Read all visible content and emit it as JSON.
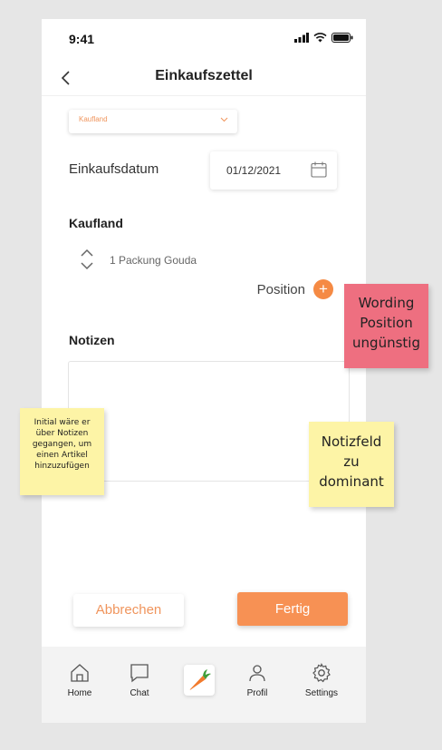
{
  "status_bar": {
    "time": "9:41"
  },
  "header": {
    "title": "Einkaufszettel"
  },
  "store_select": {
    "value": "Kaufland"
  },
  "date": {
    "label": "Einkaufsdatum",
    "value": "01/12/2021"
  },
  "list": {
    "store_name": "Kaufland",
    "items": [
      {
        "label": "1 Packung Gouda"
      }
    ],
    "add_position_label": "Position",
    "add_icon": "+"
  },
  "notes": {
    "label": "Notizen",
    "value": ""
  },
  "actions": {
    "cancel_label": "Abbrechen",
    "done_label": "Fertig"
  },
  "tabbar": {
    "home": "Home",
    "chat": "Chat",
    "profil": "Profil",
    "settings": "Settings"
  },
  "annotations": {
    "pink": [
      "Wording",
      "Position",
      "ungünstig"
    ],
    "small": [
      "Initial wäre er",
      "über Notizen",
      "gegangen, um",
      "einen Artikel",
      "hinzuzufügen"
    ],
    "big": [
      "Notizfeld",
      "zu",
      "dominant"
    ]
  },
  "colors": {
    "accent": "#f58a44",
    "pink_note": "#ee6f80",
    "yellow_note": "#fdf4a6"
  }
}
